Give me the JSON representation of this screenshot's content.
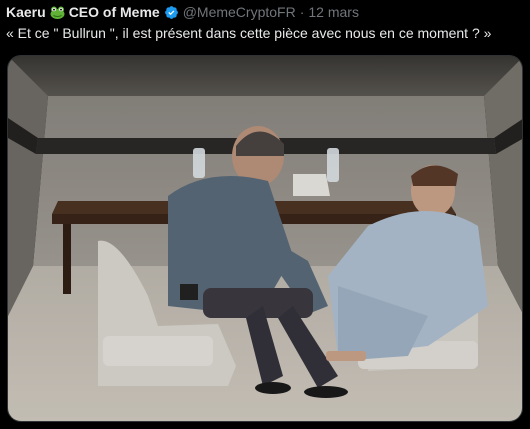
{
  "tweet": {
    "display_name_part1": "Kaeru",
    "display_name_part2": "CEO of Meme",
    "handle": "@MemeCryptoFR",
    "separator": "·",
    "date": "12 mars",
    "text": "« Et ce \" Bullrun \", il est présent dans cette pièce avec nous en ce moment ? »"
  },
  "icons": {
    "name_emoji": "frog-icon",
    "verified": "verified-badge-icon"
  },
  "colors": {
    "background": "#000000",
    "text": "#e7e9ea",
    "muted": "#71767b",
    "verified_blue": "#1d9bf0",
    "frog_green": "#5fb236"
  }
}
